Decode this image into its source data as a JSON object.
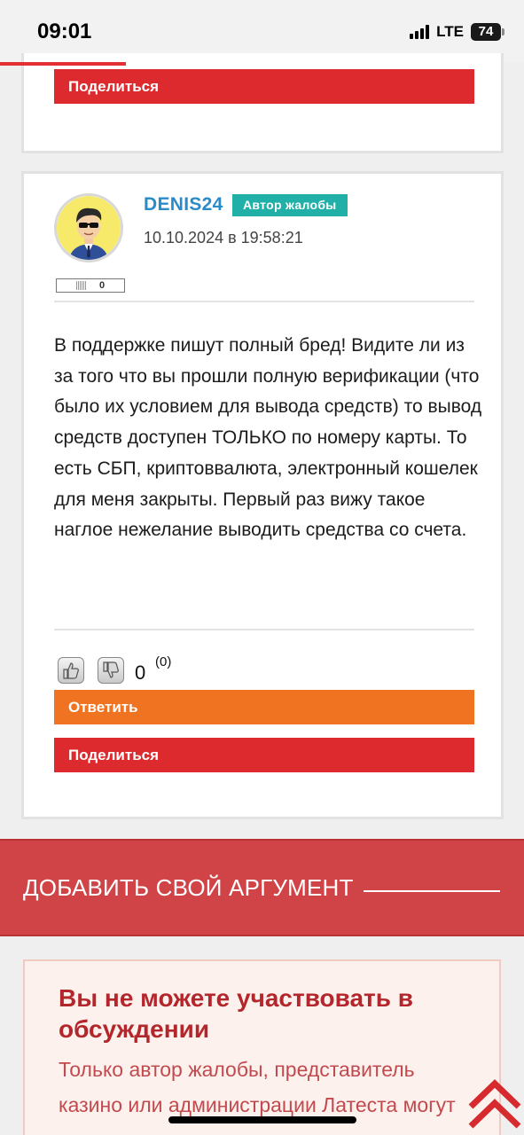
{
  "status_bar": {
    "time": "09:01",
    "network": "LTE",
    "battery": "74"
  },
  "reading_progress": 0.24,
  "top_card": {
    "share_label": "Поделиться"
  },
  "comment": {
    "author": "DENIS24",
    "author_badge": "Автор жалобы",
    "date": "10.10.2024 в 19:58:21",
    "reputation": "0",
    "text": "В поддержке пишут полный бред! Видите ли из за того что вы прошли полную верификации (что было их условием для вывода средств) то вывод средств доступен ТОЛЬКО по номеру карты. То есть СБП, криптоввалюта, электронный кошелек для меня закрыты. Первый раз вижу такое наглое нежелание выводить средства со счета.",
    "score": "0",
    "score_votes": "(0)",
    "reply_label": "Ответить",
    "share_label": "Поделиться"
  },
  "add_argument": {
    "title": "ДОБАВИТЬ СВОЙ АРГУМЕНТ"
  },
  "notice": {
    "title": "Вы не можете участвовать в обсуждении",
    "text": "Только автор жалобы, представитель казино или администрации Латеста могут участвовать в данном"
  },
  "icons": {
    "like": "thumbs-up-icon",
    "dislike": "thumbs-down-icon",
    "scroll_up": "double-chevron-up-icon",
    "avatar": "cartoon-man-avatar"
  },
  "colors": {
    "accent_red": "#dd2a2e",
    "reply_orange": "#f07322",
    "author_blue": "#2a8bc9",
    "badge_teal": "#21b0a8",
    "banner_red": "#d04448"
  }
}
